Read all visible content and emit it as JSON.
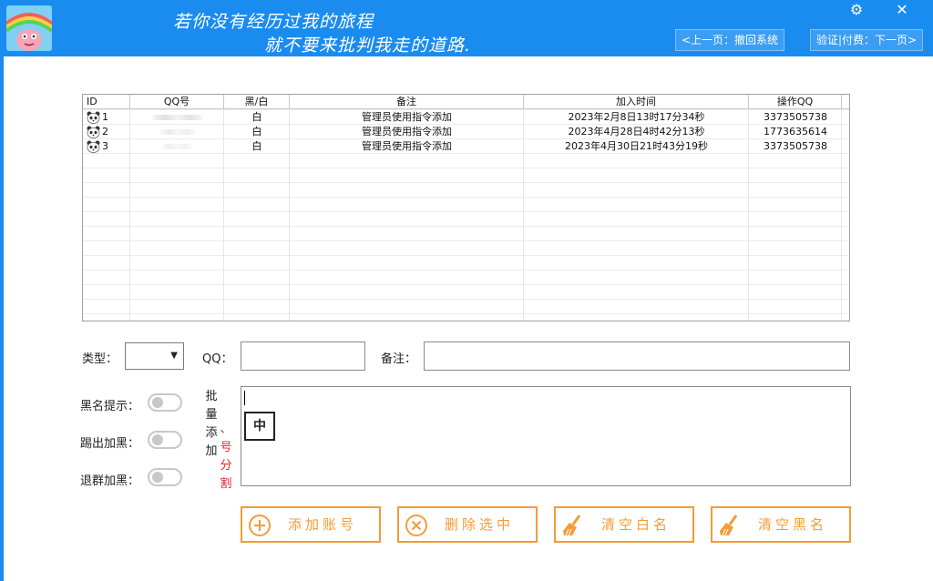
{
  "header": {
    "motto_line1": "若你没有经历过我的旅程",
    "motto_line2": "就不要来批判我走的道路.",
    "prev_button": "<上一页：撤回系统",
    "next_button": "验证|付费：下一页>",
    "settings_glyph": "⚙",
    "close_glyph": "✕"
  },
  "table": {
    "columns": [
      "ID",
      "QQ号",
      "黑/白",
      "备注",
      "加入时间",
      "操作QQ"
    ],
    "rows": [
      {
        "id": "1",
        "type": "白",
        "note": "管理员使用指令添加",
        "time": "2023年2月8日13时17分34秒",
        "operator": "3373505738"
      },
      {
        "id": "2",
        "type": "白",
        "note": "管理员使用指令添加",
        "time": "2023年4月28日4时42分13秒",
        "operator": "1773635614"
      },
      {
        "id": "3",
        "type": "白",
        "note": "管理员使用指令添加",
        "time": "2023年4月30日21时43分19秒",
        "operator": "3373505738"
      }
    ]
  },
  "form": {
    "type_label": "类型：",
    "qq_label": "QQ：",
    "note_label": "备注：",
    "type_value": "",
    "qq_value": "",
    "note_value": "",
    "batch_label": [
      "批",
      "量",
      "添",
      "加"
    ],
    "batch_hint": [
      "、",
      "号",
      "分",
      "割"
    ],
    "ime_indicator": "中"
  },
  "toggles": [
    {
      "label": "黑名提示：",
      "on": false
    },
    {
      "label": "踢出加黑：",
      "on": false
    },
    {
      "label": "退群加黑：",
      "on": false
    }
  ],
  "actions": {
    "add": "添加账号",
    "delete": "删除选中",
    "clear_white": "清空白名",
    "clear_black": "清空黑名"
  },
  "colors": {
    "header_bg": "#1a8cf0",
    "accent_orange": "#f39c38",
    "hint_red": "#e0242b"
  }
}
